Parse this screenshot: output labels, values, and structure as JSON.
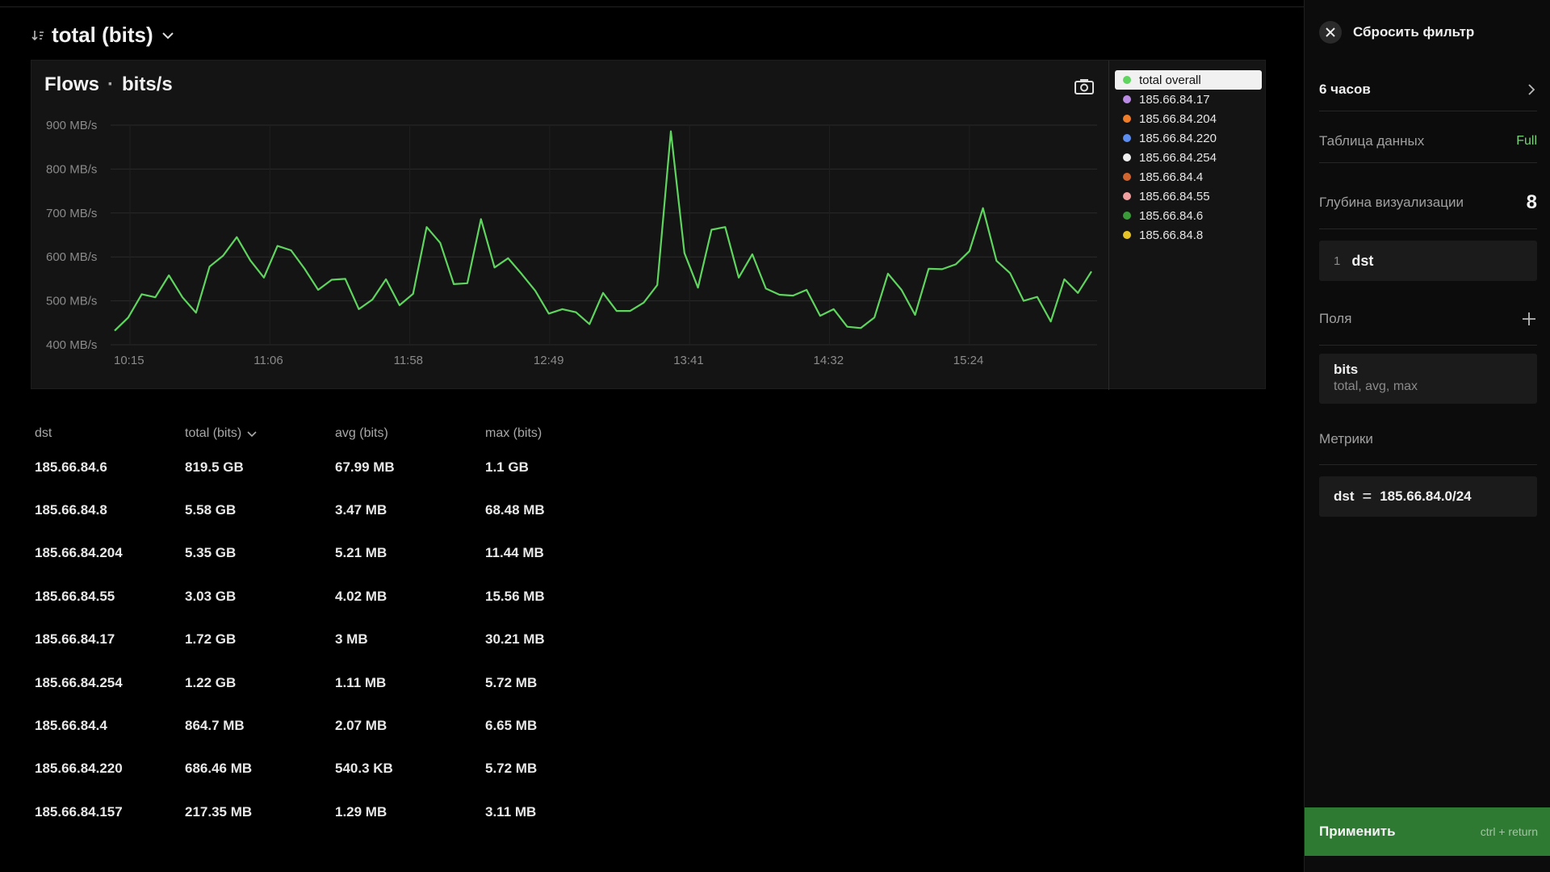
{
  "header": {
    "sort_title": "total (bits)"
  },
  "chart": {
    "title_main": "Flows",
    "title_sep": "·",
    "title_unit": "bits/s",
    "legend": [
      {
        "label": "total overall",
        "color": "#5fd45f",
        "active": true
      },
      {
        "label": "185.66.84.17",
        "color": "#b98be3"
      },
      {
        "label": "185.66.84.204",
        "color": "#f07d2a"
      },
      {
        "label": "185.66.84.220",
        "color": "#5b8ef0"
      },
      {
        "label": "185.66.84.254",
        "color": "#f0f0f0"
      },
      {
        "label": "185.66.84.4",
        "color": "#d06530"
      },
      {
        "label": "185.66.84.55",
        "color": "#f0a0a0"
      },
      {
        "label": "185.66.84.6",
        "color": "#3a9a3a"
      },
      {
        "label": "185.66.84.8",
        "color": "#e6c428"
      }
    ]
  },
  "chart_data": {
    "type": "line",
    "title": "Flows · bits/s",
    "xlabel": "",
    "ylabel": "",
    "ylim": [
      400,
      900
    ],
    "y_ticks": [
      "400 MB/s",
      "500 MB/s",
      "600 MB/s",
      "700 MB/s",
      "800 MB/s",
      "900 MB/s"
    ],
    "x_ticks": [
      "10:15",
      "11:06",
      "11:58",
      "12:49",
      "13:41",
      "14:32",
      "15:24"
    ],
    "grid": true,
    "legend_position": "right",
    "series": [
      {
        "name": "total overall",
        "color": "#5fd45f",
        "values": [
          432,
          462,
          515,
          508,
          558,
          508,
          473,
          578,
          603,
          645,
          592,
          553,
          625,
          615,
          573,
          525,
          548,
          550,
          481,
          503,
          549,
          490,
          516,
          668,
          632,
          538,
          540,
          686,
          576,
          597,
          561,
          523,
          471,
          481,
          474,
          447,
          518,
          477,
          477,
          496,
          536,
          886,
          609,
          530,
          662,
          668,
          553,
          606,
          528,
          514,
          512,
          525,
          466,
          481,
          441,
          438,
          462,
          562,
          525,
          468,
          573,
          572,
          583,
          613,
          711,
          591,
          563,
          500,
          509,
          453,
          549,
          518,
          567
        ]
      }
    ]
  },
  "table": {
    "columns": [
      "dst",
      "total (bits)",
      "avg (bits)",
      "max (bits)"
    ],
    "rows": [
      [
        "185.66.84.6",
        "819.5 GB",
        "67.99 MB",
        "1.1 GB"
      ],
      [
        "185.66.84.8",
        "5.58 GB",
        "3.47 MB",
        "68.48 MB"
      ],
      [
        "185.66.84.204",
        "5.35 GB",
        "5.21 MB",
        "11.44 MB"
      ],
      [
        "185.66.84.55",
        "3.03 GB",
        "4.02 MB",
        "15.56 MB"
      ],
      [
        "185.66.84.17",
        "1.72 GB",
        "3 MB",
        "30.21 MB"
      ],
      [
        "185.66.84.254",
        "1.22 GB",
        "1.11 MB",
        "5.72 MB"
      ],
      [
        "185.66.84.4",
        "864.7 MB",
        "2.07 MB",
        "6.65 MB"
      ],
      [
        "185.66.84.220",
        "686.46 MB",
        "540.3 KB",
        "5.72 MB"
      ],
      [
        "185.66.84.157",
        "217.35 MB",
        "1.29 MB",
        "3.11 MB"
      ]
    ]
  },
  "sidebar": {
    "reset_label": "Сбросить фильтр",
    "time_range": "6 часов",
    "data_table_label": "Таблица данных",
    "data_table_value": "Full",
    "depth_label": "Глубина визуализации",
    "depth_value": "8",
    "group_index": "1",
    "group_field": "dst",
    "fields_label": "Поля",
    "field_name": "bits",
    "field_aggs": "total, avg, max",
    "metrics_label": "Метрики",
    "filter_field": "dst",
    "filter_op": "=",
    "filter_value": "185.66.84.0/24",
    "apply_label": "Применить",
    "apply_hint": "ctrl + return"
  }
}
